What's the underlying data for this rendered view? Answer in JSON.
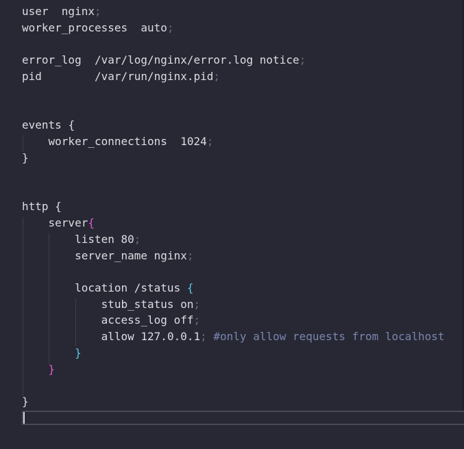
{
  "code": {
    "l1_kw": "user",
    "l1_val": "nginx",
    "l2_kw": "worker_processes",
    "l2_val": "auto",
    "l4_kw": "error_log",
    "l4_val": "/var/log/nginx/error.log notice",
    "l5_kw": "pid",
    "l5_val": "/var/run/nginx.pid",
    "l8_kw": "events",
    "l9_kw": "worker_connections",
    "l9_val": "1024",
    "l13_kw": "http",
    "l14_kw": "server",
    "l15_kw": "listen",
    "l15_val": "80",
    "l16_kw": "server_name",
    "l16_val": "nginx",
    "l18_kw": "location",
    "l18_val": "/status",
    "l19_kw": "stub_status",
    "l19_val": "on",
    "l20_kw": "access_log",
    "l20_val": "off",
    "l21_kw": "allow",
    "l21_val": "127.0.0.1",
    "l21_comment": "#only allow requests from localhost"
  },
  "punct": {
    "semi": ";",
    "open": "{",
    "close": "}"
  },
  "colors": {
    "background": "#272833",
    "text": "#dcdee4",
    "comment": "#7986b0",
    "semicolon": "#6b6e7a",
    "brace_level2": "#e25ad3",
    "brace_level3": "#5cc6e4"
  }
}
